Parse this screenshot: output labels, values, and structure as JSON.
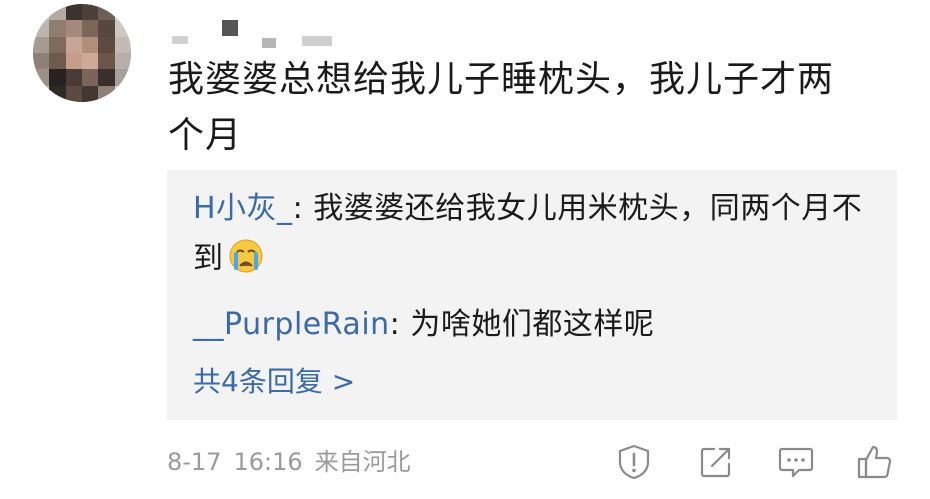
{
  "comment": {
    "text": "我婆婆总想给我儿子睡枕头，我儿子才两个月"
  },
  "replies": [
    {
      "user": "H小灰_",
      "text": ": 我婆婆还给我女儿用米枕头，同两个月不到",
      "emoji": "crying-face-icon"
    },
    {
      "user": "__PurpleRain",
      "text": ": 为啥她们都这样呢"
    }
  ],
  "more_replies": "共4条回复 >",
  "meta": {
    "date": "8-17",
    "time": "16:16",
    "location": "来自河北"
  },
  "actions": [
    "report-icon",
    "share-icon",
    "comment-icon",
    "like-icon"
  ],
  "colors": {
    "link": "#3b6aa8",
    "text": "#1a1a1a",
    "meta": "#9a9a9a",
    "reply_bg": "#f3f3f3"
  }
}
